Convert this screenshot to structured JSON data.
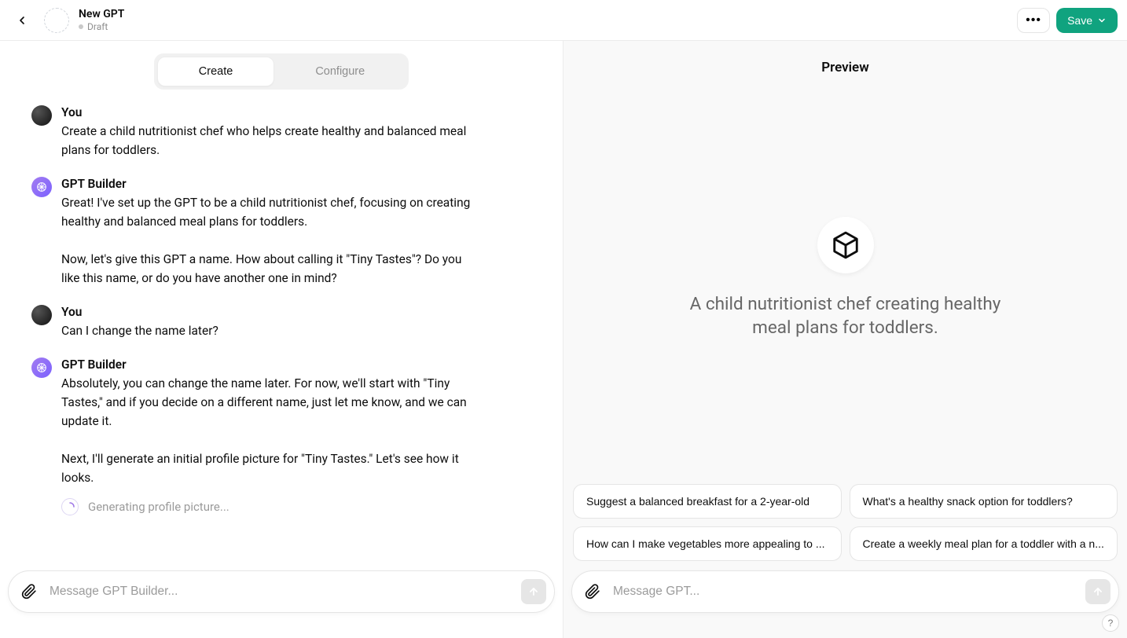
{
  "header": {
    "title": "New GPT",
    "status": "Draft",
    "save_label": "Save"
  },
  "tabs": {
    "create": "Create",
    "configure": "Configure"
  },
  "chat": [
    {
      "role": "user",
      "name": "You",
      "text": "Create a child nutritionist chef who helps create healthy and balanced meal plans for toddlers."
    },
    {
      "role": "builder",
      "name": "GPT Builder",
      "text": "Great! I've set up the GPT to be a child nutritionist chef, focusing on creating healthy and balanced meal plans for toddlers.\n\nNow, let's give this GPT a name. How about calling it \"Tiny Tastes\"? Do you like this name, or do you have another one in mind?"
    },
    {
      "role": "user",
      "name": "You",
      "text": "Can I change the name later?"
    },
    {
      "role": "builder",
      "name": "GPT Builder",
      "text": "Absolutely, you can change the name later. For now, we'll start with \"Tiny Tastes,\" and if you decide on a different name, just let me know, and we can update it.\n\nNext, I'll generate an initial profile picture for \"Tiny Tastes.\" Let's see how it looks."
    }
  ],
  "loading_text": "Generating profile picture...",
  "composer": {
    "builder_placeholder": "Message GPT Builder...",
    "preview_placeholder": "Message GPT..."
  },
  "preview": {
    "title": "Preview",
    "description": "A child nutritionist chef creating healthy meal plans for toddlers.",
    "suggestions": [
      "Suggest a balanced breakfast for a 2-year-old",
      "What's a healthy snack option for toddlers?",
      "How can I make vegetables more appealing to ...",
      "Create a weekly meal plan for a toddler with a n..."
    ]
  },
  "help_label": "?"
}
